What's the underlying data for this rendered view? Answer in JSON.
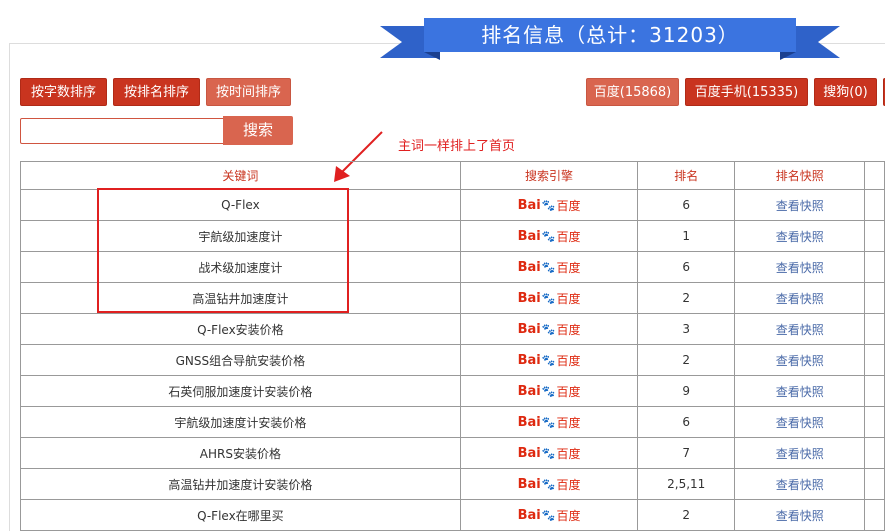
{
  "banner": {
    "title": "排名信息（总计：31203）"
  },
  "sort_buttons": [
    "按字数排序",
    "按排名排序",
    "按时间排序"
  ],
  "engine_buttons": [
    "百度(15868)",
    "百度手机(15335)",
    "搜狗(0)"
  ],
  "search": {
    "button": "搜索",
    "placeholder": ""
  },
  "note": "主词一样排上了首页",
  "table": {
    "headers": [
      "关键词",
      "搜索引擎",
      "排名",
      "排名快照"
    ],
    "engine_logo": {
      "part1": "Bai",
      "paw": "🐾",
      "part2": "百度"
    },
    "rows": [
      {
        "keyword": "Q-Flex",
        "rank": "6",
        "snapshot": "查看快照"
      },
      {
        "keyword": "宇航级加速度计",
        "rank": "1",
        "snapshot": "查看快照"
      },
      {
        "keyword": "战术级加速度计",
        "rank": "6",
        "snapshot": "查看快照"
      },
      {
        "keyword": "高温钻井加速度计",
        "rank": "2",
        "snapshot": "查看快照"
      },
      {
        "keyword": "Q-Flex安装价格",
        "rank": "3",
        "snapshot": "查看快照"
      },
      {
        "keyword": "GNSS组合导航安装价格",
        "rank": "2",
        "snapshot": "查看快照"
      },
      {
        "keyword": "石英伺服加速度计安装价格",
        "rank": "9",
        "snapshot": "查看快照"
      },
      {
        "keyword": "宇航级加速度计安装价格",
        "rank": "6",
        "snapshot": "查看快照"
      },
      {
        "keyword": "AHRS安装价格",
        "rank": "7",
        "snapshot": "查看快照"
      },
      {
        "keyword": "高温钻井加速度计安装价格",
        "rank": "2,5,11",
        "snapshot": "查看快照"
      },
      {
        "keyword": "Q-Flex在哪里买",
        "rank": "2",
        "snapshot": "查看快照"
      }
    ]
  },
  "colors": {
    "accent_red": "#c9341f",
    "banner_blue": "#3b74e0",
    "annotation_red": "#e02020"
  }
}
